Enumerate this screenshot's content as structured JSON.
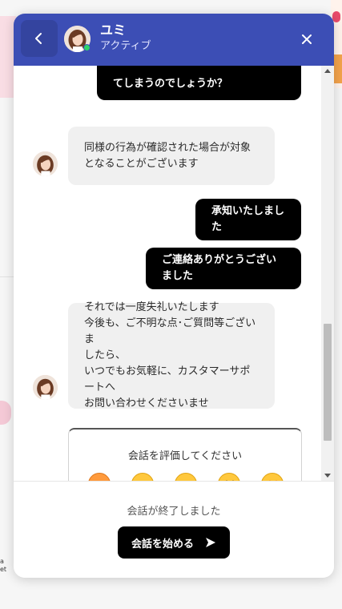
{
  "header": {
    "agent_name": "ユミ",
    "agent_status": "アクティブ",
    "back_icon": "chevron-left-icon",
    "close_icon": "close-icon",
    "color": "#3c4eb5"
  },
  "messages": [
    {
      "sender": "user",
      "text": "てしまうのでしょうか？"
    },
    {
      "sender": "agent",
      "text": "同様の行為が確認された場合が対象\nとなることがございます"
    },
    {
      "sender": "user",
      "text": "承知いたしました"
    },
    {
      "sender": "user",
      "text": "ご連絡ありがとうございました"
    },
    {
      "sender": "agent",
      "text": "それでは一度失礼いたします\n今後も、ご不明な点･ご質問等ございま\nしたら、\nいつでもお気軽に、カスタマーサポートへ\nお問い合わせくださいませ"
    }
  ],
  "rating": {
    "title": "会話を評価してください",
    "emojis": [
      "angry-face-icon",
      "frowning-face-icon",
      "neutral-face-icon",
      "grinning-face-icon",
      "star-struck-face-icon"
    ]
  },
  "footer": {
    "ended_text": "会話が終了しました",
    "start_button_label": "会話を始める",
    "start_button_icon": "send-icon"
  },
  "background": {
    "snippet_text": "a\net"
  }
}
